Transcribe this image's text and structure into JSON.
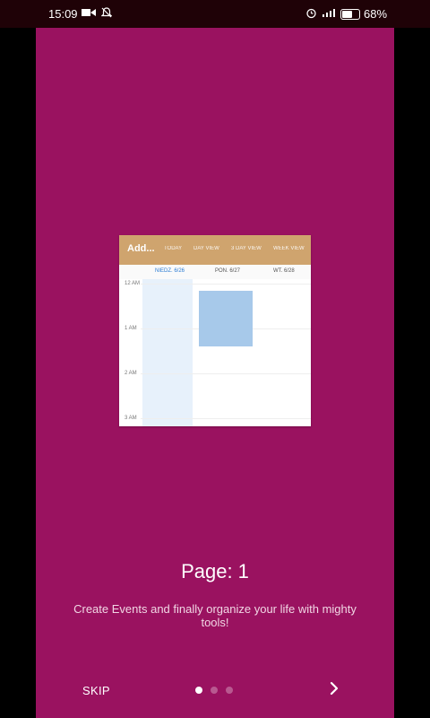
{
  "statusbar": {
    "time": "15:09",
    "icons": [
      "video-icon",
      "notifications-off-icon",
      "alarm-icon",
      "signal-icon",
      "battery-icon"
    ],
    "battery_percent": "68%",
    "battery_level": 0.68
  },
  "app": {
    "background": "#9a1260",
    "preview": {
      "toolbar_color": "#cfa46e",
      "toolbar_title": "Add...",
      "tabs": [
        "TODAY",
        "DAY VIEW",
        "3 DAY VIEW",
        "WEEK VIEW"
      ],
      "days": [
        {
          "label": "NIEDZ. 6/26",
          "today": true
        },
        {
          "label": "PON. 6/27",
          "today": false
        },
        {
          "label": "WT. 6/28",
          "today": false
        }
      ],
      "hours": [
        "12 AM",
        "1 AM",
        "2 AM",
        "3 AM"
      ],
      "event_color": "#a7c9ea"
    },
    "title": "Page: 1",
    "subtitle": "Create Events and finally organize your life with mighty tools!",
    "bottom_nav": {
      "skip_label": "SKIP",
      "page_count": 3,
      "current_page": 1,
      "next_icon": "chevron-right-icon"
    }
  }
}
